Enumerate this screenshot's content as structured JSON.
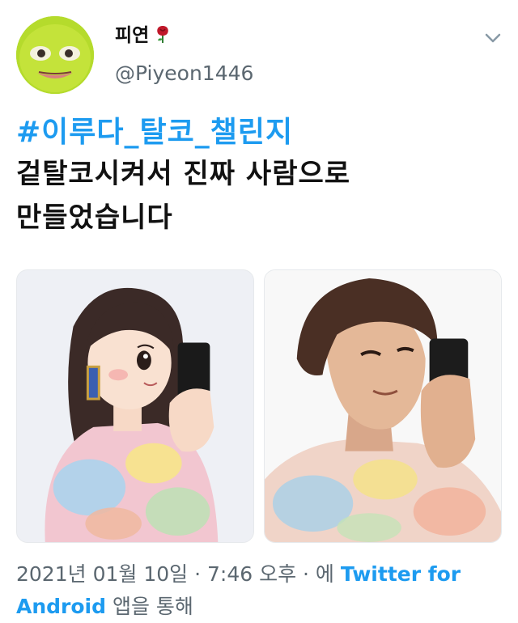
{
  "user": {
    "display_name": "피연",
    "handle": "@Piyeon1446",
    "avatar": "avatar-icon",
    "name_emoji": "rose-icon"
  },
  "tweet": {
    "hashtag": "#이루다_탈코_챌린지",
    "line1": "겉탈코시켜서 진짜 사람으로",
    "line2": "만들었습니다"
  },
  "media": [
    {
      "name": "cartoon-girl-selfie"
    },
    {
      "name": "realistic-boy-selfie"
    }
  ],
  "meta": {
    "date": "2021년 01월 10일",
    "sep1": " · ",
    "time": "7:46 오후",
    "sep2": " · ",
    "via": "에",
    "source_part1": "Twitter for",
    "source_part2": "Android",
    "suffix": "앱을 통해"
  },
  "colors": {
    "link": "#1d9bf0",
    "secondary": "#5b6770",
    "text": "#111111"
  }
}
